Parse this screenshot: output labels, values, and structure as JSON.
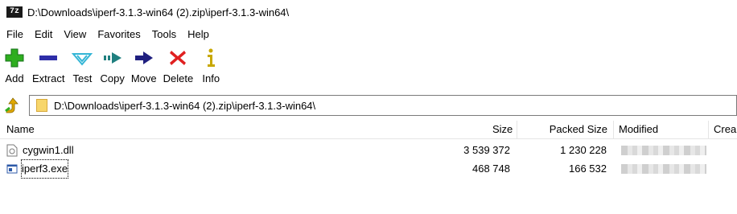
{
  "window": {
    "app_icon": "7z",
    "title": "D:\\Downloads\\iperf-3.1.3-win64 (2).zip\\iperf-3.1.3-win64\\"
  },
  "menu": [
    "File",
    "Edit",
    "View",
    "Favorites",
    "Tools",
    "Help"
  ],
  "toolbar": {
    "add": "Add",
    "extract": "Extract",
    "test": "Test",
    "copy": "Copy",
    "move": "Move",
    "delete": "Delete",
    "info": "Info"
  },
  "address": {
    "path": "D:\\Downloads\\iperf-3.1.3-win64 (2).zip\\iperf-3.1.3-win64\\"
  },
  "columns": {
    "name": "Name",
    "size": "Size",
    "packed": "Packed Size",
    "modified": "Modified",
    "created": "Crea"
  },
  "files": [
    {
      "name": "cygwin1.dll",
      "size": "3 539 372",
      "packed": "1 230 228",
      "icon": "dll-file-icon"
    },
    {
      "name": "iperf3.exe",
      "size": "468 748",
      "packed": "166 532",
      "icon": "exe-file-icon"
    }
  ],
  "colors": {
    "add": "#2eae1f",
    "extract": "#2e2ea8",
    "test": "#35b6d6",
    "copy": "#1f7f7f",
    "move": "#1f1f7f",
    "delete": "#e02020",
    "info": "#c8a800"
  }
}
